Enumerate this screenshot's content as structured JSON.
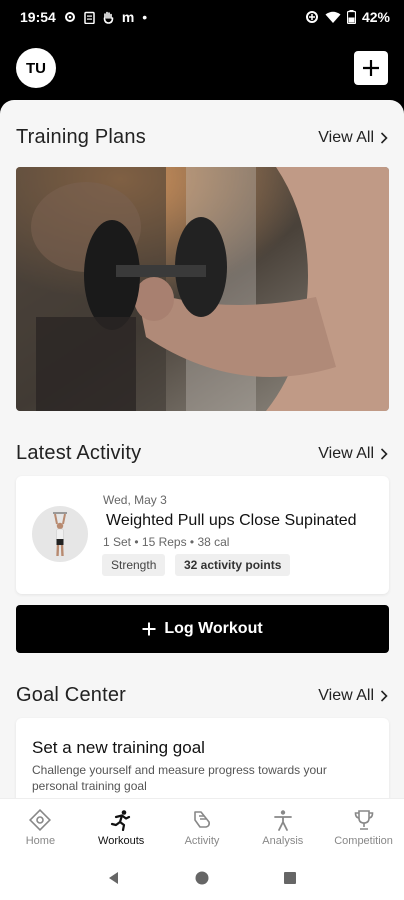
{
  "status_bar": {
    "time": "19:54",
    "notif_icons": [
      "settings-icon",
      "clipboard-icon",
      "hand-icon",
      "m-logo-icon",
      "dot-icon"
    ],
    "battery": "42%"
  },
  "header": {
    "avatar_initials": "TU"
  },
  "training_plans": {
    "title": "Training Plans",
    "view_all": "View All"
  },
  "latest_activity": {
    "title": "Latest Activity",
    "view_all": "View All",
    "item": {
      "date": "Wed, May 3",
      "name": "Weighted Pull ups Close Supinated",
      "meta": "1 Set • 15 Reps • 38 cal",
      "tags": [
        "Strength",
        "32 activity points"
      ]
    }
  },
  "log_workout": {
    "label": "Log Workout"
  },
  "goal_center": {
    "title": "Goal Center",
    "view_all": "View All",
    "card_title": "Set a new training goal",
    "card_desc": "Challenge yourself and measure progress towards your personal training goal"
  },
  "bottom_nav": [
    {
      "label": "Home",
      "icon": "home-icon",
      "active": false
    },
    {
      "label": "Workouts",
      "icon": "workouts-icon",
      "active": true
    },
    {
      "label": "Activity",
      "icon": "activity-icon",
      "active": false
    },
    {
      "label": "Analysis",
      "icon": "analysis-icon",
      "active": false
    },
    {
      "label": "Competition",
      "icon": "trophy-icon",
      "active": false
    }
  ],
  "colors": {
    "primary": "#000000",
    "surface": "#ffffff",
    "background": "#f6f6f6",
    "inactive": "#888888"
  }
}
